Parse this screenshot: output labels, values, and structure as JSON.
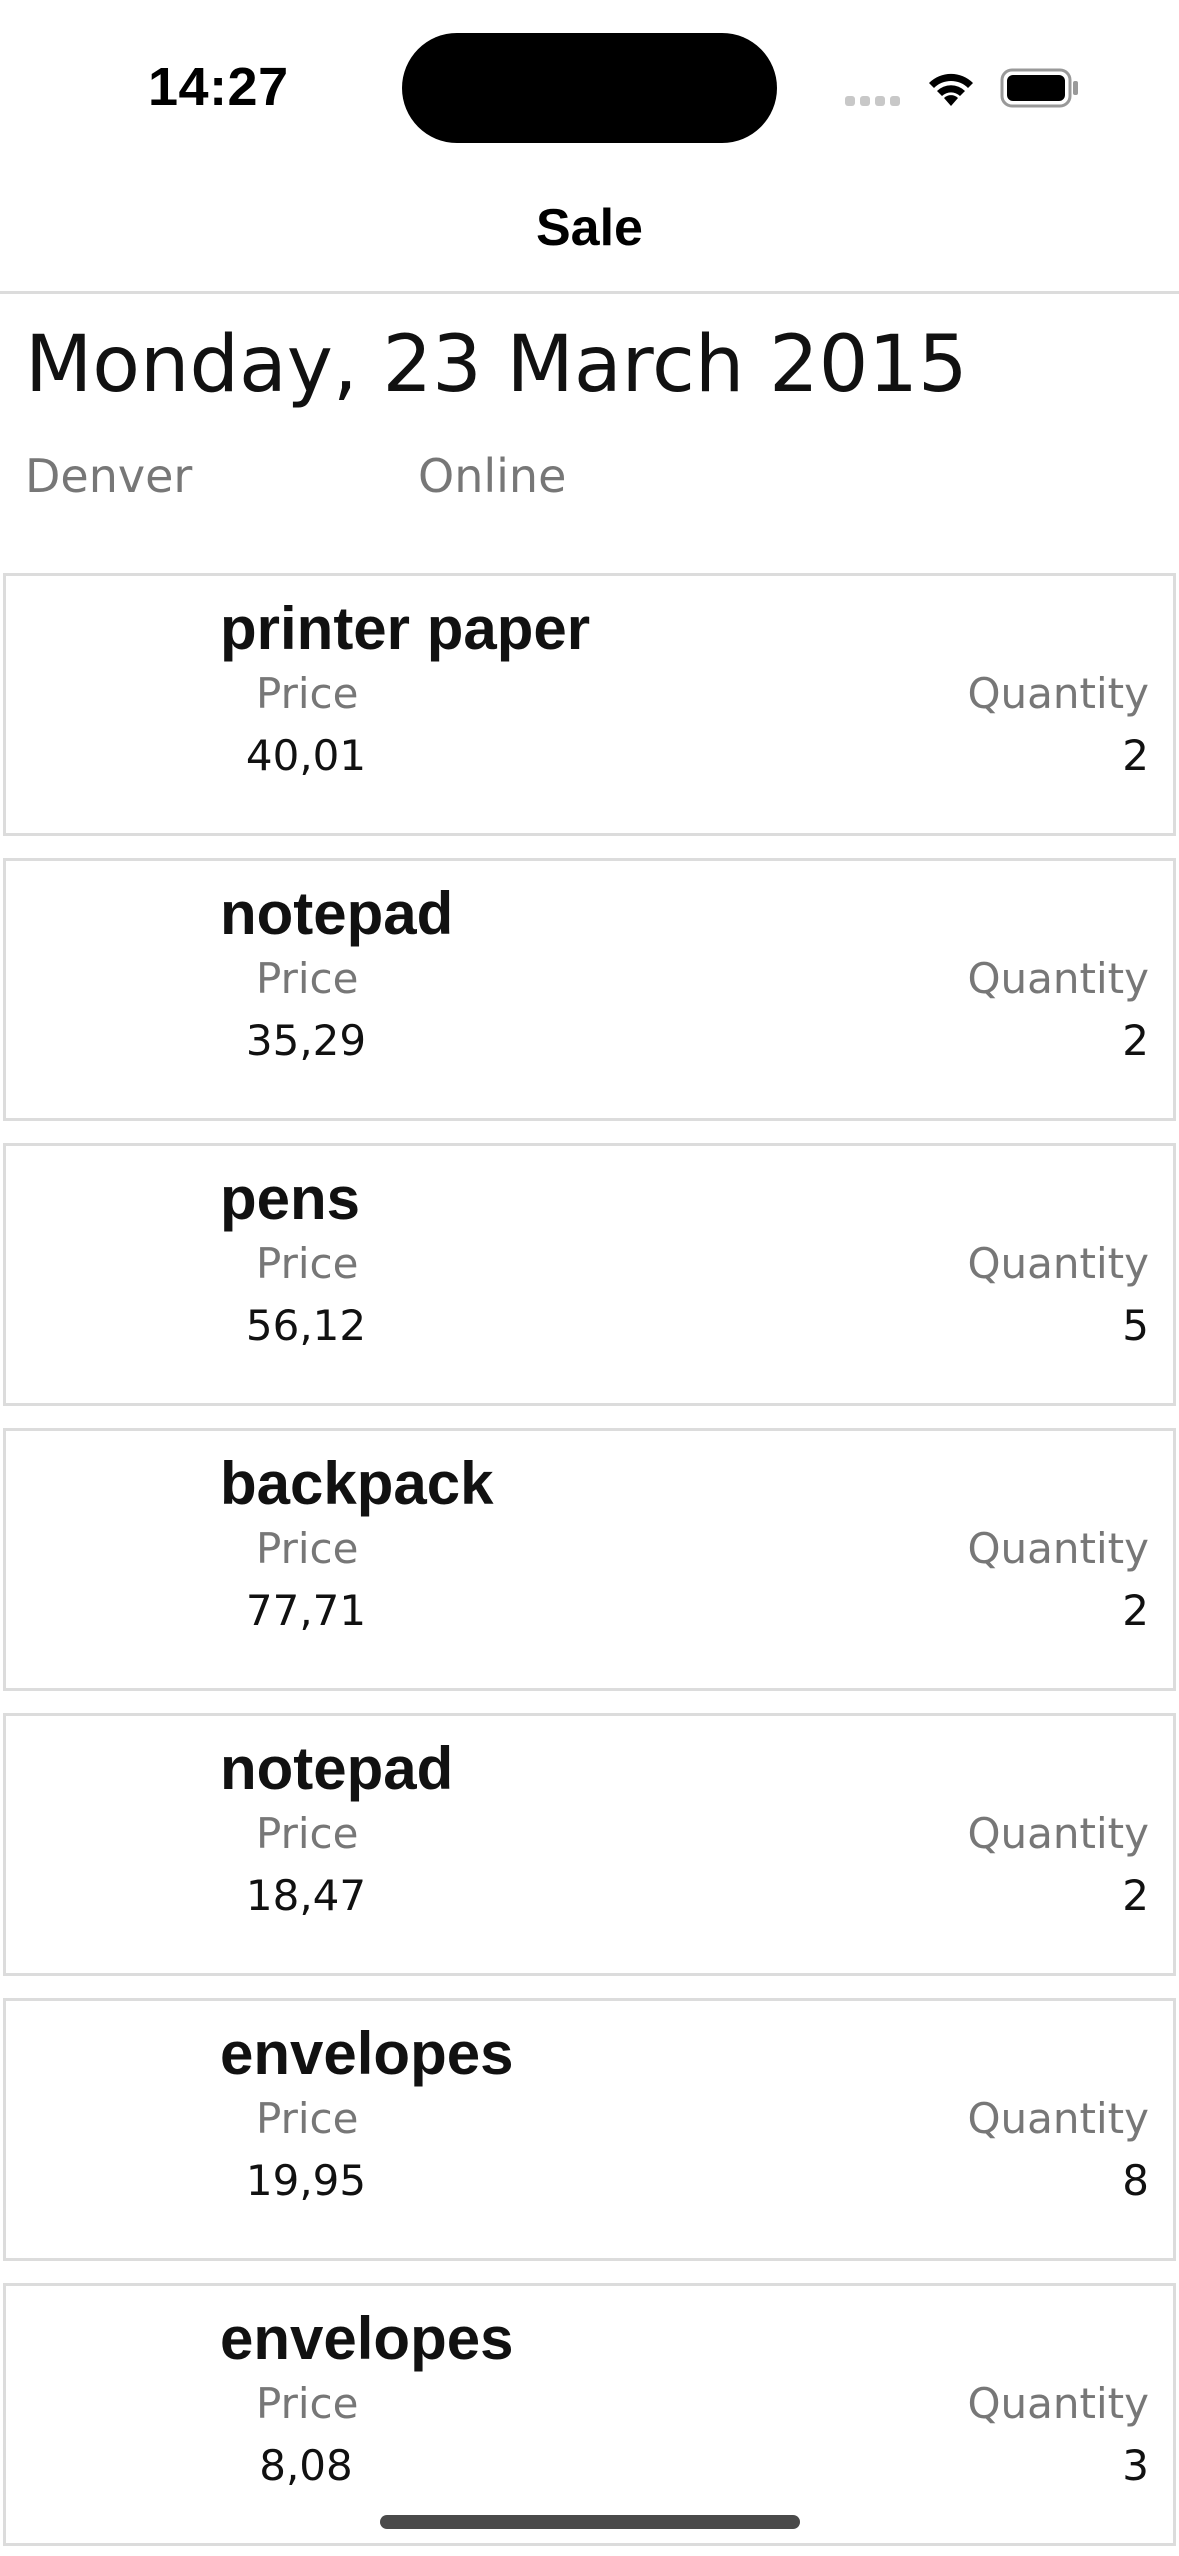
{
  "status_bar": {
    "time": "14:27",
    "icons": [
      "cellular-signal-icon",
      "wifi-icon",
      "battery-icon"
    ]
  },
  "nav": {
    "title": "Sale"
  },
  "sale": {
    "date": "Monday, 23 March 2015",
    "location": "Denver",
    "channel": "Online"
  },
  "labels": {
    "price": "Price",
    "quantity": "Quantity"
  },
  "items": [
    {
      "name": "printer paper",
      "price": "40,01",
      "quantity": "2"
    },
    {
      "name": "notepad",
      "price": "35,29",
      "quantity": "2"
    },
    {
      "name": "pens",
      "price": "56,12",
      "quantity": "5"
    },
    {
      "name": "backpack",
      "price": "77,71",
      "quantity": "2"
    },
    {
      "name": "notepad",
      "price": "18,47",
      "quantity": "2"
    },
    {
      "name": "envelopes",
      "price": "19,95",
      "quantity": "8"
    },
    {
      "name": "envelopes",
      "price": "8,08",
      "quantity": "3"
    }
  ],
  "colors": {
    "card_border": "#dcdcdc",
    "secondary_text": "#777777",
    "primary_text": "#111111"
  }
}
